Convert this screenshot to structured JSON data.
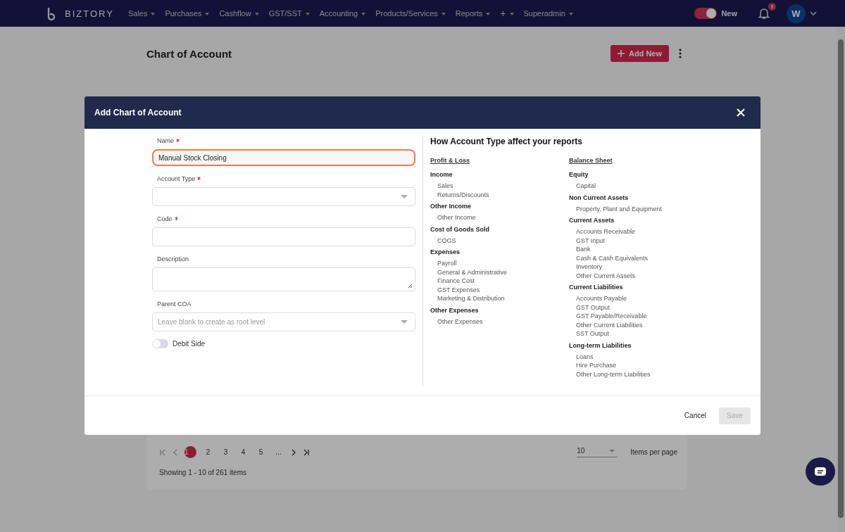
{
  "navbar": {
    "brand": "BIZTORY",
    "menu": [
      {
        "label": "Sales",
        "kind": "text"
      },
      {
        "label": "Purchases",
        "kind": "text"
      },
      {
        "label": "Cashflow",
        "kind": "text"
      },
      {
        "label": "GST/SST",
        "kind": "text"
      },
      {
        "label": "Accounting",
        "kind": "text"
      },
      {
        "label": "Products/Services",
        "kind": "text"
      },
      {
        "label": "Reports",
        "kind": "text"
      },
      {
        "label": "+",
        "kind": "icon"
      },
      {
        "label": "Superadmin",
        "kind": "text"
      }
    ],
    "new_toggle": {
      "label": "New",
      "on": true
    },
    "notifications": {
      "count": "9"
    },
    "avatar": {
      "initial": "W"
    }
  },
  "page": {
    "title": "Chart of Account",
    "add_button": "Add New",
    "pagination": {
      "pages": [
        {
          "label": "1",
          "selected": true
        },
        {
          "label": "2",
          "selected": false
        },
        {
          "label": "3",
          "selected": false
        },
        {
          "label": "4",
          "selected": false
        },
        {
          "label": "5",
          "selected": false
        },
        {
          "label": "...",
          "selected": false
        }
      ],
      "page_size": "10",
      "page_size_label": "Items per page",
      "summary": "Showing 1 - 10 of 261 items"
    }
  },
  "dialog": {
    "title": "Add Chart of Account",
    "fields": [
      {
        "label": "Name",
        "required": true,
        "kind": "text",
        "value": "Manual Stock Closing",
        "focused": true
      },
      {
        "label": "Account Type",
        "required": true,
        "kind": "select",
        "focused": false
      },
      {
        "label": "Code",
        "required": true,
        "kind": "text",
        "focused": false
      },
      {
        "label": "Description",
        "required": false,
        "kind": "textarea",
        "focused": false
      },
      {
        "label": "Parent COA",
        "required": false,
        "kind": "select",
        "placeholder": "Leave blank to create as root level",
        "focused": false
      }
    ],
    "debit_side": {
      "label": "Debit Side",
      "on": false
    },
    "info": {
      "title": "How Account Type affect your reports",
      "columns": [
        {
          "heading": "Profit & Loss",
          "groups": [
            {
              "name": "Income",
              "items": [
                "Sales",
                "Returns/Discounts"
              ]
            },
            {
              "name": "Other Income",
              "items": [
                "Other Income"
              ]
            },
            {
              "name": "Cost of Goods Sold",
              "items": [
                "COGS"
              ]
            },
            {
              "name": "Expenses",
              "items": [
                "Payroll",
                "General & Administrative",
                "Finance Cost",
                "GST Expenses",
                "Marketing & Distribution"
              ]
            },
            {
              "name": "Other Expenses",
              "items": [
                "Other Expenses"
              ]
            }
          ]
        },
        {
          "heading": "Balance Sheet",
          "groups": [
            {
              "name": "Equity",
              "items": [
                "Capital"
              ]
            },
            {
              "name": "Non Current Assets",
              "items": [
                "Property, Plant and Equipment"
              ]
            },
            {
              "name": "Current Assets",
              "items": [
                "Accounts Receivable",
                "GST Input",
                "Bank",
                "Cash & Cash Equivalents",
                "Inventory",
                "Other Current Assets"
              ]
            },
            {
              "name": "Current Liabilities",
              "items": [
                "Accounts Payable",
                "GST Output",
                "GST Payable/Receivable",
                "Other Current Liabilities",
                "SST Output"
              ]
            },
            {
              "name": "Long-term Liabilities",
              "items": [
                "Loans",
                "Hire Purchase",
                "Other Long-term Liabilities"
              ]
            }
          ]
        }
      ]
    },
    "buttons": [
      {
        "label": "Cancel",
        "kind": "text",
        "disabled": false
      },
      {
        "label": "Save",
        "kind": "filled",
        "disabled": true
      }
    ]
  }
}
